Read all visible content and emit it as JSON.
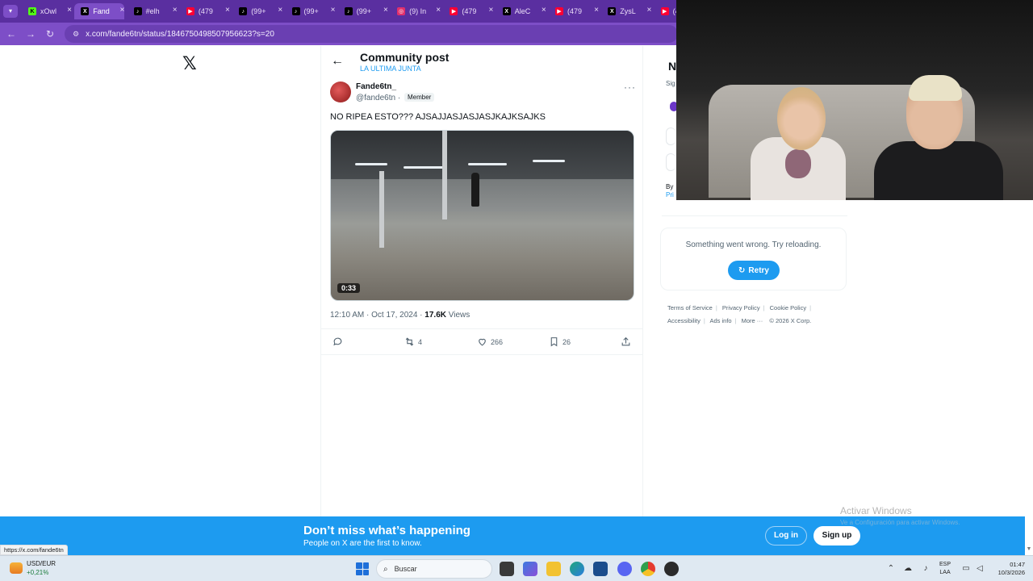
{
  "browser": {
    "tabs": [
      {
        "label": "xOwl",
        "icon": "kick-icon",
        "color": "#1a1a1a"
      },
      {
        "label": "Fand",
        "icon": "x-icon",
        "color": "#000000",
        "active": true
      },
      {
        "label": "#elh",
        "icon": "tiktok-icon",
        "color": "#000000"
      },
      {
        "label": "(479",
        "icon": "youtube-icon",
        "color": "#ff0033"
      },
      {
        "label": "(99+",
        "icon": "tiktok-icon",
        "color": "#000000"
      },
      {
        "label": "(99+",
        "icon": "tiktok-icon",
        "color": "#000000"
      },
      {
        "label": "(99+",
        "icon": "tiktok-icon",
        "color": "#000000"
      },
      {
        "label": "(9) In",
        "icon": "instagram-icon",
        "color": "#e1306c"
      },
      {
        "label": "(479",
        "icon": "youtube-icon",
        "color": "#ff0033"
      },
      {
        "label": "AleC",
        "icon": "x-icon",
        "color": "#000000"
      },
      {
        "label": "(479",
        "icon": "youtube-icon",
        "color": "#ff0033"
      },
      {
        "label": "ZysL",
        "icon": "x-icon",
        "color": "#000000"
      },
      {
        "label": "(4",
        "icon": "youtube-icon",
        "color": "#ff0033"
      }
    ],
    "url": "x.com/fande6tn/status/1846750498507956623?s=20"
  },
  "post": {
    "header_title": "Community post",
    "header_subtitle": "LA ULTIMA JUNTA",
    "author_name": "Fande6tn_",
    "author_handle": "@fande6tn ·",
    "badge": "Member",
    "text": "NO RIPEA ESTO??? AJSAJJASJASJASJKAJKSAJKS",
    "video_duration": "0:33",
    "timestamp": "12:10 AM · Oct 17, 2024 · ",
    "views_count": "17.6K",
    "views_label": " Views",
    "retweets": "4",
    "likes": "266",
    "bookmarks": "26"
  },
  "sidebar": {
    "initial": "N",
    "sign_fragment": "Sig",
    "by_fragment": "By",
    "pri_fragment": "Pri",
    "error_message": "Something went wrong. Try reloading.",
    "retry_label": "Retry",
    "footer_links": [
      "Terms of Service",
      "Privacy Policy",
      "Cookie Policy",
      "Accessibility",
      "Ads info",
      "More ···",
      "© 2026 X Corp."
    ]
  },
  "banner": {
    "title": "Don’t miss what’s happening",
    "subtitle": "People on X are the first to know.",
    "login_label": "Log in",
    "signup_label": "Sign up"
  },
  "status_bar_url": "https://x.com/fande6tn",
  "windows_watermark": "Activar Windows",
  "windows_watermark_sub": "Ve a Configuración para activar Windows.",
  "taskbar": {
    "stock_name": "USD/EUR",
    "stock_change": "+0,21%",
    "search_placeholder": "Buscar",
    "lang_line1": "ESP",
    "lang_line2": "LAA",
    "time": "01:47",
    "date": "10/3/2026"
  },
  "colors": {
    "x_blue": "#1d9bf0",
    "browser_purple": "#7d4ec7"
  }
}
